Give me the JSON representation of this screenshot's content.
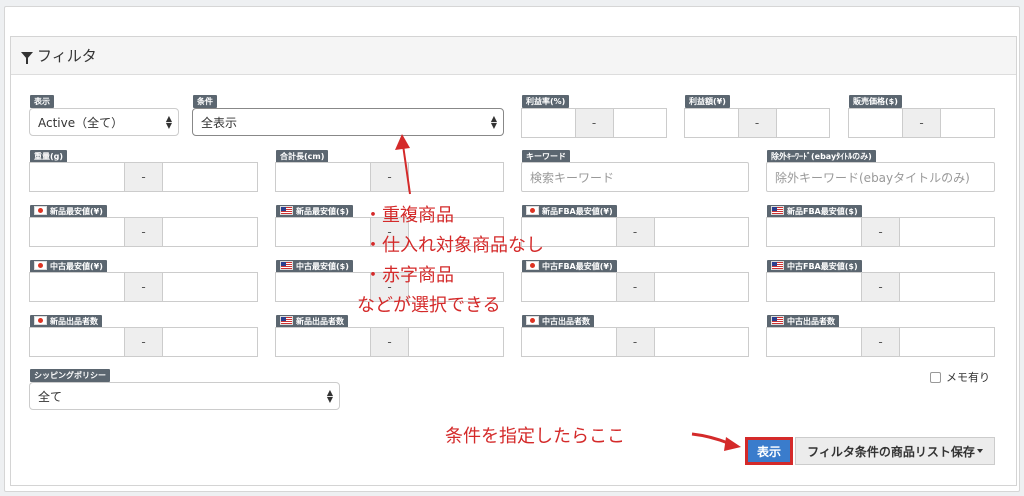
{
  "header": {
    "title": "フィルタ"
  },
  "row1": {
    "display": {
      "label": "表示",
      "value": "Active（全て）"
    },
    "condition": {
      "label": "条件",
      "value": "全表示"
    },
    "profit_rate": {
      "label": "利益率(%)",
      "sep": "-"
    },
    "profit_amount": {
      "label": "利益額(¥)",
      "sep": "-"
    },
    "sale_price": {
      "label": "販売価格($)",
      "sep": "-"
    }
  },
  "row2": {
    "weight": {
      "label": "重量(g)",
      "sep": "-"
    },
    "total_length": {
      "label": "合計長(cm)",
      "sep": "-"
    },
    "keyword": {
      "label": "キーワード",
      "placeholder": "検索キーワード"
    },
    "exclude_keyword": {
      "label": "除外ｷｰﾜｰﾄﾞ(ebayﾀｲﾄﾙのみ)",
      "placeholder": "除外キーワード(ebayタイトルのみ)"
    }
  },
  "row3": {
    "new_min_jp": {
      "label": "新品最安値(¥)",
      "sep": "-"
    },
    "new_min_us": {
      "label": "新品最安値($)",
      "sep": "-"
    },
    "new_fba_min_jp": {
      "label": "新品FBA最安値(¥)",
      "sep": "-"
    },
    "new_fba_min_us": {
      "label": "新品FBA最安値($)",
      "sep": "-"
    }
  },
  "row4": {
    "used_min_jp": {
      "label": "中古最安値(¥)",
      "sep": "-"
    },
    "used_min_us": {
      "label": "中古最安値($)",
      "sep": "-"
    },
    "used_fba_min_jp": {
      "label": "中古FBA最安値(¥)",
      "sep": "-"
    },
    "used_fba_min_us": {
      "label": "中古FBA最安値($)",
      "sep": "-"
    }
  },
  "row5": {
    "new_sellers_jp": {
      "label": "新品出品者数",
      "sep": "-"
    },
    "new_sellers_us": {
      "label": "新品出品者数",
      "sep": "-"
    },
    "used_sellers_jp": {
      "label": "中古出品者数",
      "sep": "-"
    },
    "used_sellers_us": {
      "label": "中古出品者数",
      "sep": "-"
    }
  },
  "shipping": {
    "label": "シッピングポリシー",
    "value": "全て"
  },
  "memo": {
    "label": "メモ有り",
    "checked": false
  },
  "buttons": {
    "show": "表示",
    "save": "フィルタ条件の商品リスト保存"
  },
  "annotations": {
    "list": [
      "・重複商品",
      "・仕入れ対象商品なし",
      "・赤字商品",
      "などが選択できる"
    ],
    "bottom": "条件を指定したらここ"
  },
  "colors": {
    "primary": "#3a7ccc",
    "annotation": "#d42a2a",
    "label_bg": "#5b6670"
  },
  "icons": {
    "header": "filter-icon",
    "jp": "japan-flag-icon",
    "us": "us-flag-icon"
  }
}
